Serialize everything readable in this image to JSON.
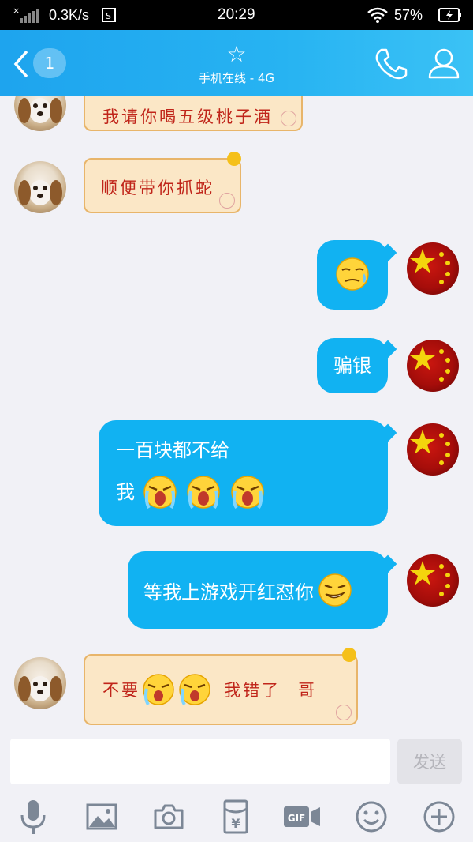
{
  "status": {
    "speed": "0.3K/s",
    "time": "20:29",
    "battery": "57%"
  },
  "header": {
    "back_count": "1",
    "star": "☆",
    "status": "手机在线 - 4G"
  },
  "messages": {
    "m1": "我请你喝五级桃子酒",
    "m2": "顺便带你抓蛇",
    "m4": "骗银",
    "m5_line1": "一百块都不给",
    "m5_line2": "我",
    "m6": "等我上游戏开红怼你",
    "m7_a": "不要",
    "m7_b": "我错了",
    "m7_c": "哥"
  },
  "input": {
    "send_label": "发送",
    "placeholder": ""
  },
  "colors": {
    "header": "#1ea4ee",
    "bubble": "#11b2f2",
    "scroll_bg": "#fbe7c6",
    "scroll_text": "#c0251a"
  },
  "icons": [
    "microphone-icon",
    "image-icon",
    "camera-icon",
    "red-packet-icon",
    "gif-icon",
    "emoji-icon",
    "plus-icon"
  ]
}
